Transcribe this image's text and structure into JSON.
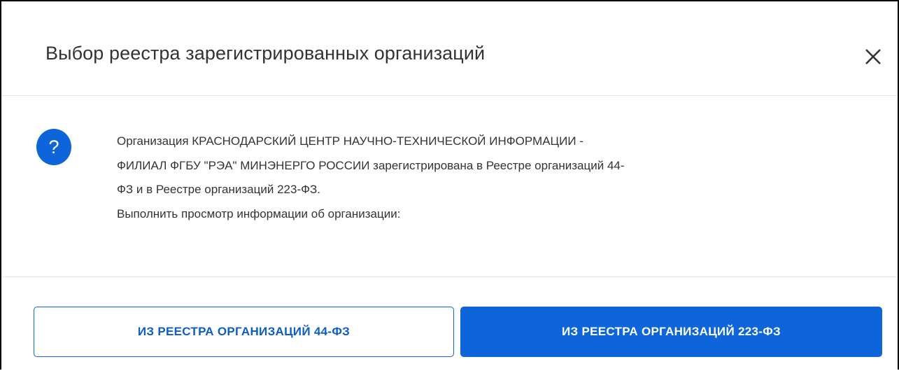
{
  "dialog": {
    "title": "Выбор реестра зарегистрированных организаций",
    "close_icon": "close-icon"
  },
  "body": {
    "icon": "question-icon",
    "icon_glyph": "?",
    "icon_color": "#0d65d9",
    "message_line_1": "Организация КРАСНОДАРСКИЙ ЦЕНТР НАУЧНО-ТЕХНИЧЕСКОЙ ИНФОРМАЦИИ -",
    "message_line_2": "ФИЛИАЛ ФГБУ \"РЭА\" МИНЭНЕРГО РОССИИ зарегистрирована в Реестре организаций 44-",
    "message_line_3": "ФЗ и в Реестре организаций 223-ФЗ.",
    "prompt": "Выполнить просмотр информации об организации:"
  },
  "footer": {
    "button_44fz_label": "ИЗ РЕЕСТРА ОРГАНИЗАЦИЙ 44-ФЗ",
    "button_223fz_label": "ИЗ РЕЕСТРА ОРГАНИЗАЦИЙ 223-ФЗ",
    "accent_color": "#0d65d9"
  }
}
